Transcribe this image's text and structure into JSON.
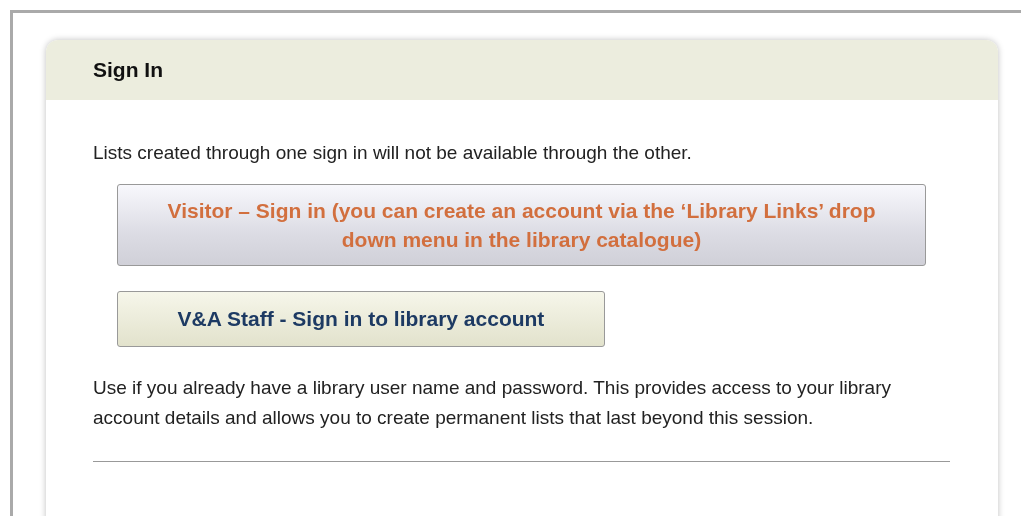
{
  "panel": {
    "title": "Sign In",
    "intro": "Lists created through one sign in will not be available through the other.",
    "buttons": [
      {
        "label": "Visitor – Sign in (you can create an account via the ‘Library Links’ drop down menu in the library catalogue)",
        "kind": "visitor"
      },
      {
        "label": "V&A Staff - Sign in to library account",
        "kind": "staff"
      }
    ],
    "note": "Use if you already have a library user name and password. This provides access to your library account details and allows you to create permanent lists that last beyond this session."
  }
}
